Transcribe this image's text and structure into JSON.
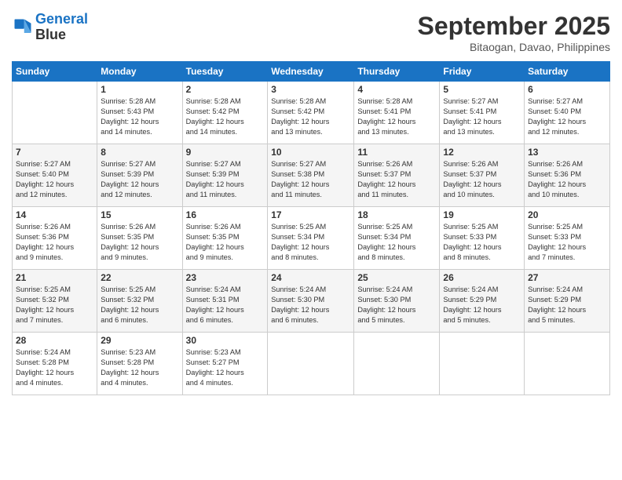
{
  "header": {
    "logo_line1": "General",
    "logo_line2": "Blue",
    "title": "September 2025",
    "subtitle": "Bitaogan, Davao, Philippines"
  },
  "weekdays": [
    "Sunday",
    "Monday",
    "Tuesday",
    "Wednesday",
    "Thursday",
    "Friday",
    "Saturday"
  ],
  "weeks": [
    [
      {
        "day": "",
        "info": ""
      },
      {
        "day": "1",
        "info": "Sunrise: 5:28 AM\nSunset: 5:43 PM\nDaylight: 12 hours\nand 14 minutes."
      },
      {
        "day": "2",
        "info": "Sunrise: 5:28 AM\nSunset: 5:42 PM\nDaylight: 12 hours\nand 14 minutes."
      },
      {
        "day": "3",
        "info": "Sunrise: 5:28 AM\nSunset: 5:42 PM\nDaylight: 12 hours\nand 13 minutes."
      },
      {
        "day": "4",
        "info": "Sunrise: 5:28 AM\nSunset: 5:41 PM\nDaylight: 12 hours\nand 13 minutes."
      },
      {
        "day": "5",
        "info": "Sunrise: 5:27 AM\nSunset: 5:41 PM\nDaylight: 12 hours\nand 13 minutes."
      },
      {
        "day": "6",
        "info": "Sunrise: 5:27 AM\nSunset: 5:40 PM\nDaylight: 12 hours\nand 12 minutes."
      }
    ],
    [
      {
        "day": "7",
        "info": "Sunrise: 5:27 AM\nSunset: 5:40 PM\nDaylight: 12 hours\nand 12 minutes."
      },
      {
        "day": "8",
        "info": "Sunrise: 5:27 AM\nSunset: 5:39 PM\nDaylight: 12 hours\nand 12 minutes."
      },
      {
        "day": "9",
        "info": "Sunrise: 5:27 AM\nSunset: 5:39 PM\nDaylight: 12 hours\nand 11 minutes."
      },
      {
        "day": "10",
        "info": "Sunrise: 5:27 AM\nSunset: 5:38 PM\nDaylight: 12 hours\nand 11 minutes."
      },
      {
        "day": "11",
        "info": "Sunrise: 5:26 AM\nSunset: 5:37 PM\nDaylight: 12 hours\nand 11 minutes."
      },
      {
        "day": "12",
        "info": "Sunrise: 5:26 AM\nSunset: 5:37 PM\nDaylight: 12 hours\nand 10 minutes."
      },
      {
        "day": "13",
        "info": "Sunrise: 5:26 AM\nSunset: 5:36 PM\nDaylight: 12 hours\nand 10 minutes."
      }
    ],
    [
      {
        "day": "14",
        "info": "Sunrise: 5:26 AM\nSunset: 5:36 PM\nDaylight: 12 hours\nand 9 minutes."
      },
      {
        "day": "15",
        "info": "Sunrise: 5:26 AM\nSunset: 5:35 PM\nDaylight: 12 hours\nand 9 minutes."
      },
      {
        "day": "16",
        "info": "Sunrise: 5:26 AM\nSunset: 5:35 PM\nDaylight: 12 hours\nand 9 minutes."
      },
      {
        "day": "17",
        "info": "Sunrise: 5:25 AM\nSunset: 5:34 PM\nDaylight: 12 hours\nand 8 minutes."
      },
      {
        "day": "18",
        "info": "Sunrise: 5:25 AM\nSunset: 5:34 PM\nDaylight: 12 hours\nand 8 minutes."
      },
      {
        "day": "19",
        "info": "Sunrise: 5:25 AM\nSunset: 5:33 PM\nDaylight: 12 hours\nand 8 minutes."
      },
      {
        "day": "20",
        "info": "Sunrise: 5:25 AM\nSunset: 5:33 PM\nDaylight: 12 hours\nand 7 minutes."
      }
    ],
    [
      {
        "day": "21",
        "info": "Sunrise: 5:25 AM\nSunset: 5:32 PM\nDaylight: 12 hours\nand 7 minutes."
      },
      {
        "day": "22",
        "info": "Sunrise: 5:25 AM\nSunset: 5:32 PM\nDaylight: 12 hours\nand 6 minutes."
      },
      {
        "day": "23",
        "info": "Sunrise: 5:24 AM\nSunset: 5:31 PM\nDaylight: 12 hours\nand 6 minutes."
      },
      {
        "day": "24",
        "info": "Sunrise: 5:24 AM\nSunset: 5:30 PM\nDaylight: 12 hours\nand 6 minutes."
      },
      {
        "day": "25",
        "info": "Sunrise: 5:24 AM\nSunset: 5:30 PM\nDaylight: 12 hours\nand 5 minutes."
      },
      {
        "day": "26",
        "info": "Sunrise: 5:24 AM\nSunset: 5:29 PM\nDaylight: 12 hours\nand 5 minutes."
      },
      {
        "day": "27",
        "info": "Sunrise: 5:24 AM\nSunset: 5:29 PM\nDaylight: 12 hours\nand 5 minutes."
      }
    ],
    [
      {
        "day": "28",
        "info": "Sunrise: 5:24 AM\nSunset: 5:28 PM\nDaylight: 12 hours\nand 4 minutes."
      },
      {
        "day": "29",
        "info": "Sunrise: 5:23 AM\nSunset: 5:28 PM\nDaylight: 12 hours\nand 4 minutes."
      },
      {
        "day": "30",
        "info": "Sunrise: 5:23 AM\nSunset: 5:27 PM\nDaylight: 12 hours\nand 4 minutes."
      },
      {
        "day": "",
        "info": ""
      },
      {
        "day": "",
        "info": ""
      },
      {
        "day": "",
        "info": ""
      },
      {
        "day": "",
        "info": ""
      }
    ]
  ]
}
